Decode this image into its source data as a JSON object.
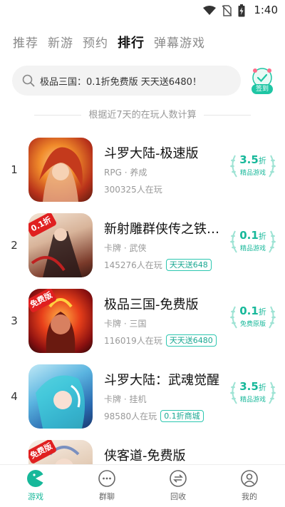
{
  "status_bar": {
    "time": "1:40"
  },
  "tabs": [
    {
      "label": "推荐",
      "active": false
    },
    {
      "label": "新游",
      "active": false
    },
    {
      "label": "预约",
      "active": false
    },
    {
      "label": "排行",
      "active": true
    },
    {
      "label": "弹幕游戏",
      "active": false
    }
  ],
  "search": {
    "text": "极品三国：0.1折免费版 天天送6480！"
  },
  "signin": {
    "label": "签到"
  },
  "rank_note": "根据近7天的在玩人数计算",
  "games": [
    {
      "rank": "1",
      "title": "斗罗大陆-极速版",
      "tags": "RPG · 养成",
      "players": "300325人在玩",
      "promo": "",
      "discount": "3.5",
      "discount_unit": "折",
      "discount_note": "精品游戏",
      "badge": ""
    },
    {
      "rank": "2",
      "title": "新射雕群侠传之铁血丹心",
      "tags": "卡牌 · 武侠",
      "players": "145276人在玩",
      "promo": "天天送648",
      "discount": "0.1",
      "discount_unit": "折",
      "discount_note": "精品游戏",
      "badge": "0.1折"
    },
    {
      "rank": "3",
      "title": "极品三国-免费版",
      "tags": "卡牌 · 三国",
      "players": "116019人在玩",
      "promo": "天天送6480",
      "discount": "0.1",
      "discount_unit": "折",
      "discount_note": "免费原版",
      "badge": "免费版"
    },
    {
      "rank": "4",
      "title": "斗罗大陆：武魂觉醒",
      "tags": "卡牌 · 挂机",
      "players": "98580人在玩",
      "promo": "0.1折商城",
      "discount": "3.5",
      "discount_unit": "折",
      "discount_note": "精品游戏",
      "badge": ""
    },
    {
      "rank": "5",
      "title": "侠客道-免费版",
      "tags": "",
      "players": "",
      "promo": "",
      "discount": "",
      "discount_unit": "",
      "discount_note": "",
      "badge": "免费版"
    }
  ],
  "bottom_nav": [
    {
      "label": "游戏",
      "icon": "game-icon",
      "active": true
    },
    {
      "label": "群聊",
      "icon": "chat-icon",
      "active": false
    },
    {
      "label": "回收",
      "icon": "recycle-icon",
      "active": false
    },
    {
      "label": "我的",
      "icon": "profile-icon",
      "active": false
    }
  ],
  "colors": {
    "accent": "#17b89a",
    "promo_border": "#2cc7b0",
    "badge_red": "#e02020"
  }
}
